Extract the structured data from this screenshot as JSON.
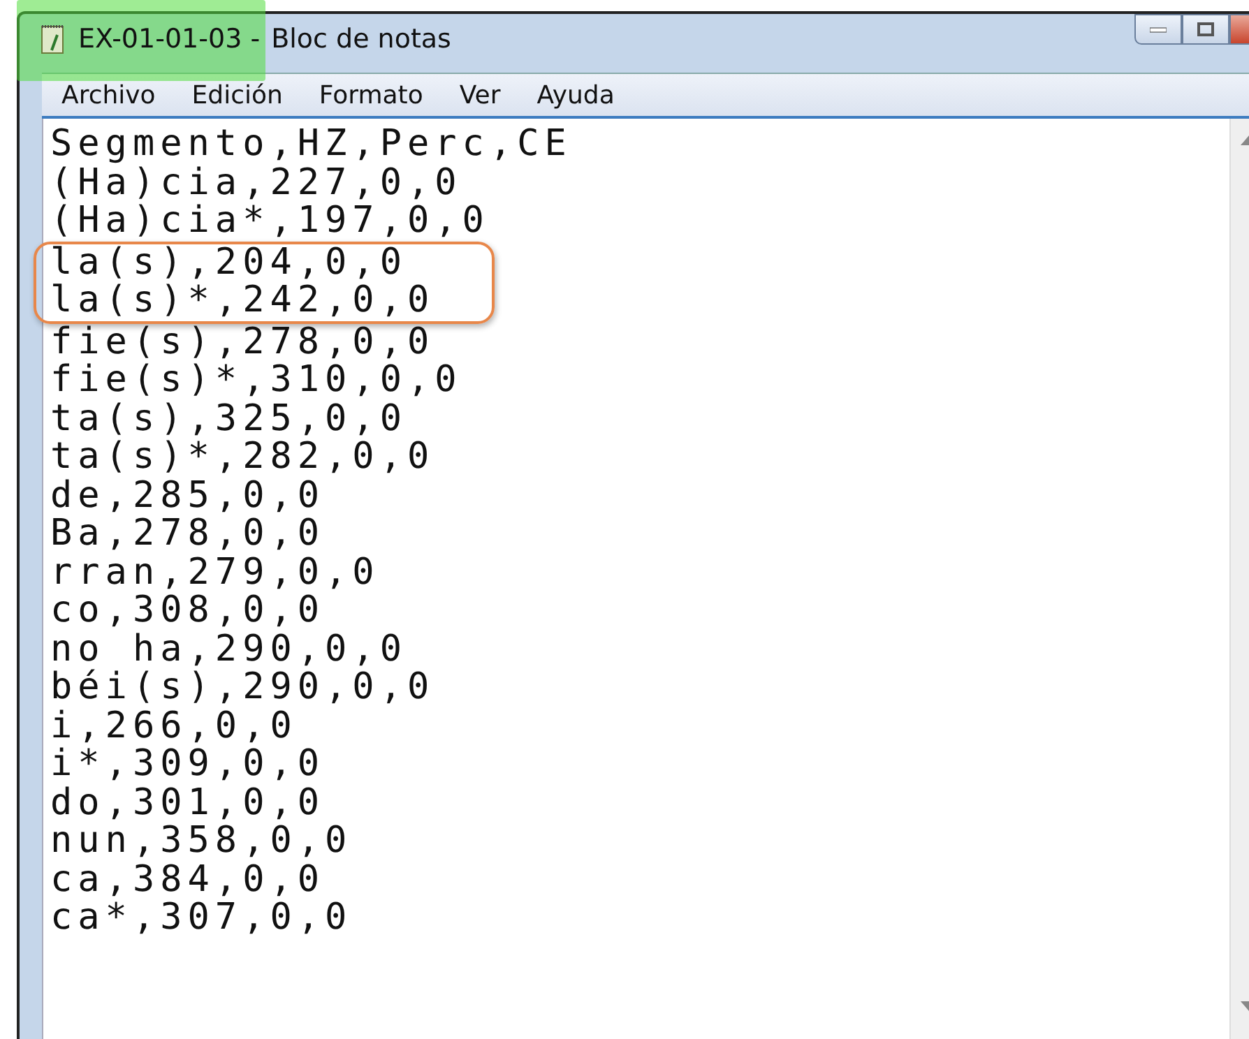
{
  "window": {
    "title_highlighted": "EX-01-01-03 -",
    "title_rest": "Bloc de notas"
  },
  "menu": [
    "Archivo",
    "Edición",
    "Formato",
    "Ver",
    "Ayuda"
  ],
  "lines": [
    {
      "text": "Segmento,HZ,Perc,CE",
      "highlighted": false
    },
    {
      "text": "(Ha)cia,227,0,0",
      "highlighted": false
    },
    {
      "text": "(Ha)cia*,197,0,0",
      "highlighted": false
    },
    {
      "text": "la(s),204,0,0",
      "highlighted": true
    },
    {
      "text": "la(s)*,242,0,0",
      "highlighted": true
    },
    {
      "text": "fie(s),278,0,0",
      "highlighted": false
    },
    {
      "text": "fie(s)*,310,0,0",
      "highlighted": false
    },
    {
      "text": "ta(s),325,0,0",
      "highlighted": false
    },
    {
      "text": "ta(s)*,282,0,0",
      "highlighted": false
    },
    {
      "text": "de,285,0,0",
      "highlighted": false
    },
    {
      "text": "Ba,278,0,0",
      "highlighted": false
    },
    {
      "text": "rran,279,0,0",
      "highlighted": false
    },
    {
      "text": "co,308,0,0",
      "highlighted": false
    },
    {
      "text": "no ha,290,0,0",
      "highlighted": false
    },
    {
      "text": "béi(s),290,0,0",
      "highlighted": false
    },
    {
      "text": "i,266,0,0",
      "highlighted": false
    },
    {
      "text": "i*,309,0,0",
      "highlighted": false
    },
    {
      "text": "do,301,0,0",
      "highlighted": false
    },
    {
      "text": "nun,358,0,0",
      "highlighted": false
    },
    {
      "text": "ca,384,0,0",
      "highlighted": false
    },
    {
      "text": "ca*,307,0,0",
      "highlighted": false
    }
  ]
}
